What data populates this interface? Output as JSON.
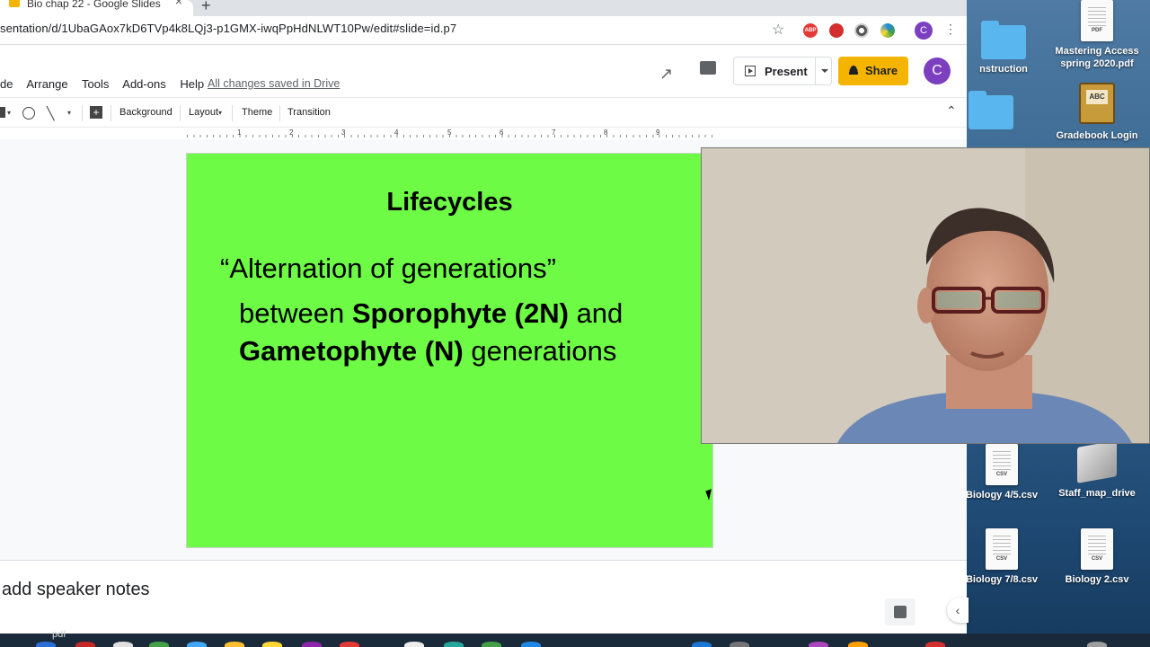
{
  "browser": {
    "tab_title": "Bio chap 22 - Google Slides",
    "url": "sentation/d/1UbaGAox7kD6TVp4k8LQj3-p1GMX-iwqPpHdNLWT10Pw/edit#slide=id.p7",
    "profile_initial": "C"
  },
  "header": {
    "menu": [
      "de",
      "Arrange",
      "Tools",
      "Add-ons",
      "Help"
    ],
    "saved_status": "All changes saved in Drive",
    "present_label": "Present",
    "share_label": "Share",
    "avatar_initial": "C"
  },
  "toolbar": {
    "background": "Background",
    "layout": "Layout",
    "theme": "Theme",
    "transition": "Transition"
  },
  "ruler": [
    "1",
    "2",
    "3",
    "4",
    "5",
    "6",
    "7",
    "8",
    "9"
  ],
  "slide": {
    "title": "Lifecycles",
    "line1": "“Alternation of generations”",
    "line2_pre": "between ",
    "line2_bold": "Sporophyte (2N)",
    "line2_post": " and",
    "line3_bold": "Gametophyte (N)",
    "line3_post": " generations",
    "background_color": "#6dfb45"
  },
  "notes": {
    "placeholder": "add speaker notes"
  },
  "desktop": {
    "items": [
      {
        "label": "Mastering Access spring 2020.pdf",
        "tag": "PDF"
      },
      {
        "label": "nstruction"
      },
      {
        "label": "Gradebook Login"
      },
      {
        "label": "Biology 4/5.csv",
        "tag": "CSV"
      },
      {
        "label": "Staff_map_drive"
      },
      {
        "label": "Biology 7/8.csv",
        "tag": "CSV"
      },
      {
        "label": "Biology 2.csv",
        "tag": "CSV"
      }
    ]
  },
  "dock": {
    "label": "pdf"
  }
}
